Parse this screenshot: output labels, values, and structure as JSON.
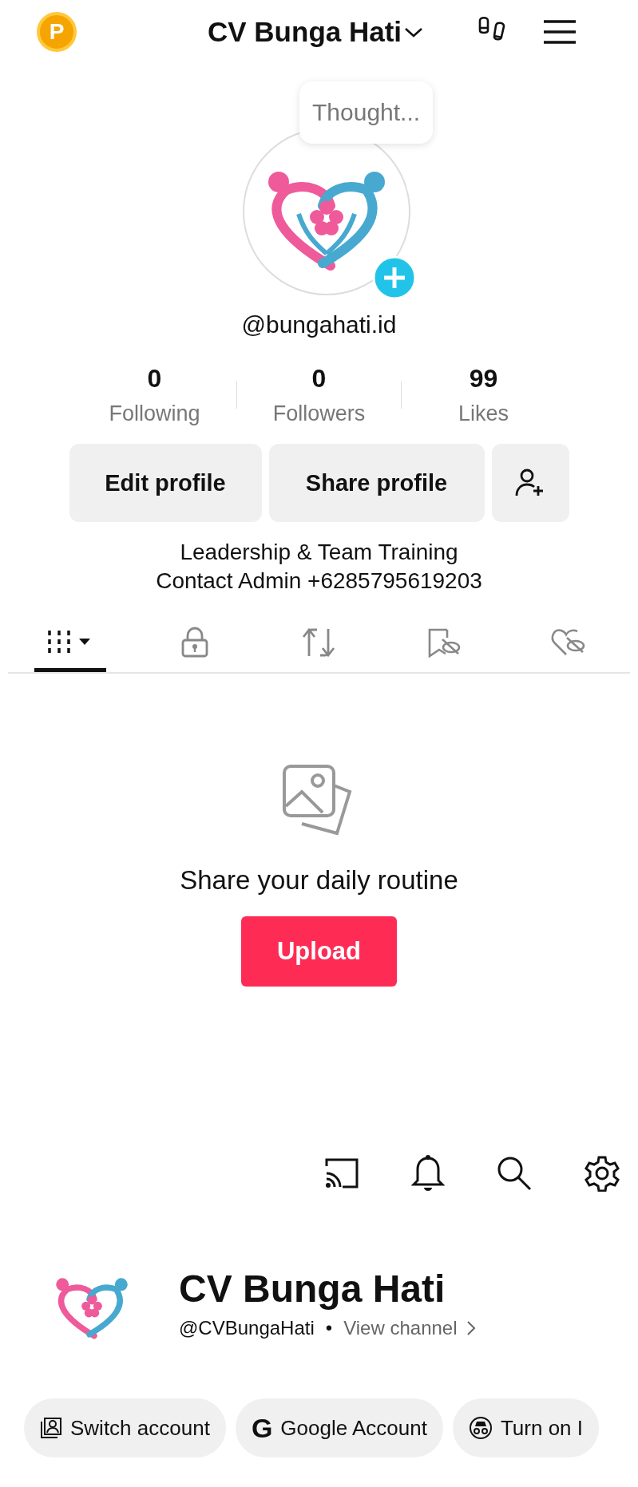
{
  "top_bar": {
    "coin_label": "P",
    "account_name": "CV Bunga Hati"
  },
  "profile": {
    "note": "Thought...",
    "handle": "@bungahati.id",
    "stats": [
      {
        "value": "0",
        "label": "Following"
      },
      {
        "value": "0",
        "label": "Followers"
      },
      {
        "value": "99",
        "label": "Likes"
      }
    ],
    "buttons": [
      "Edit profile",
      "Share profile"
    ],
    "bio": [
      "Leadership & Team Training",
      "Contact Admin +6285795619203"
    ]
  },
  "tabs": [
    {
      "kind": "grid",
      "selected": true
    },
    {
      "kind": "private",
      "selected": false
    },
    {
      "kind": "repost",
      "selected": false
    },
    {
      "kind": "saved",
      "selected": false
    },
    {
      "kind": "liked",
      "selected": false
    }
  ],
  "empty_state": {
    "message": "Share your daily routine",
    "button": "Upload"
  },
  "channel": {
    "name": "CV Bunga Hati",
    "handle": "@CVBungaHati",
    "separator": "•",
    "link": "View channel"
  },
  "chips": [
    {
      "kind": "switch",
      "label": "Switch account"
    },
    {
      "kind": "google",
      "label": "Google Account",
      "icon_text": "G"
    },
    {
      "kind": "incognito",
      "label": "Turn on I"
    }
  ]
}
